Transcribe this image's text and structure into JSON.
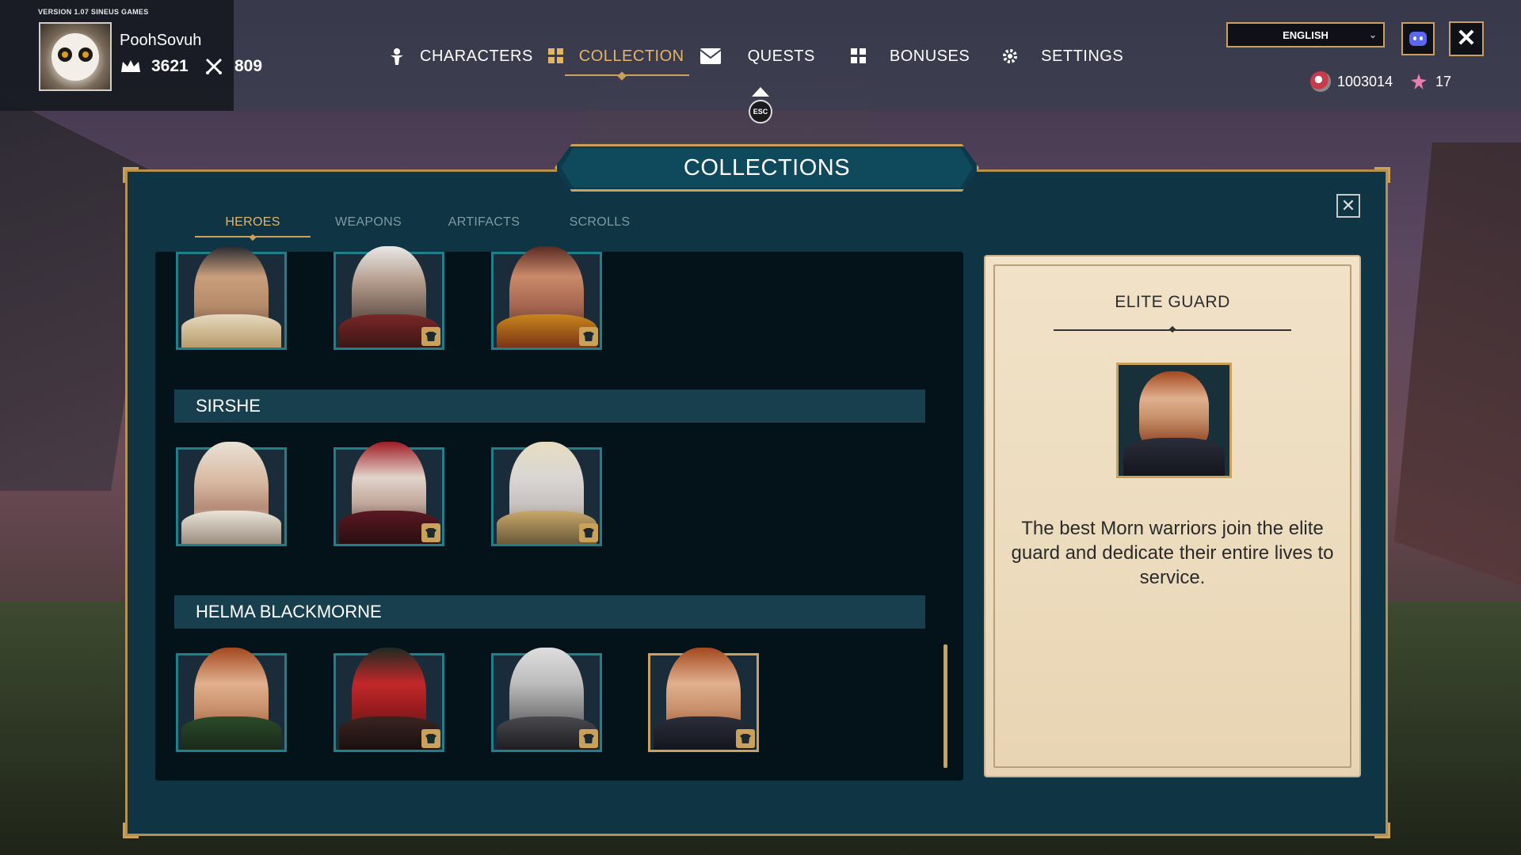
{
  "app": {
    "version": "VERSION 1.07 SINEUS GAMES"
  },
  "profile": {
    "username": "PoohSovuh",
    "crowns": "3621",
    "swords": "809"
  },
  "nav": [
    {
      "label": "CHARACTERS",
      "icon": "character-icon"
    },
    {
      "label": "COLLECTION",
      "icon": "grid-icon",
      "active": true
    },
    {
      "label": "QUESTS",
      "icon": "envelope-icon"
    },
    {
      "label": "BONUSES",
      "icon": "grid-icon"
    },
    {
      "label": "SETTINGS",
      "icon": "gear-icon"
    }
  ],
  "esc_label": "ESC",
  "language": {
    "selected": "ENGLISH"
  },
  "currency": {
    "coins": "1003014",
    "flowers": "17"
  },
  "panel": {
    "title": "COLLECTIONS",
    "tabs": [
      "HEROES",
      "WEAPONS",
      "ARTIFACTS",
      "SCROLLS"
    ],
    "active_tab": "HEROES"
  },
  "groups": [
    {
      "name": "SIRSHE"
    },
    {
      "name": "HELMA BLACKMORNE"
    }
  ],
  "detail": {
    "title": "ELITE GUARD",
    "description": "The best Morn warriors join the elite guard and dedicate their entire lives to service."
  },
  "colors": {
    "accent_gold": "#c9a15a",
    "panel_teal": "#0f3444",
    "portrait_border": "#1f7f8a"
  }
}
